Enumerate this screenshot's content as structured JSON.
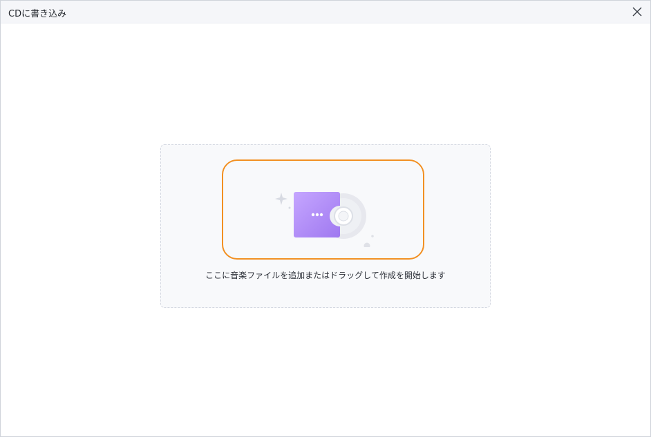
{
  "window": {
    "title": "CDに書き込み"
  },
  "icons": {
    "close": "close-icon",
    "illustration": "cd-folder-illustration-icon",
    "sparkle": "sparkle-icon"
  },
  "dropzone": {
    "hint": "ここに音楽ファイルを追加またはドラッグして作成を開始します"
  },
  "colors": {
    "highlight": "#f29022",
    "folder_purple": "#a37cf2",
    "folder_purple_light": "#c4a8ff",
    "disc_gray": "#e4e6ec"
  }
}
